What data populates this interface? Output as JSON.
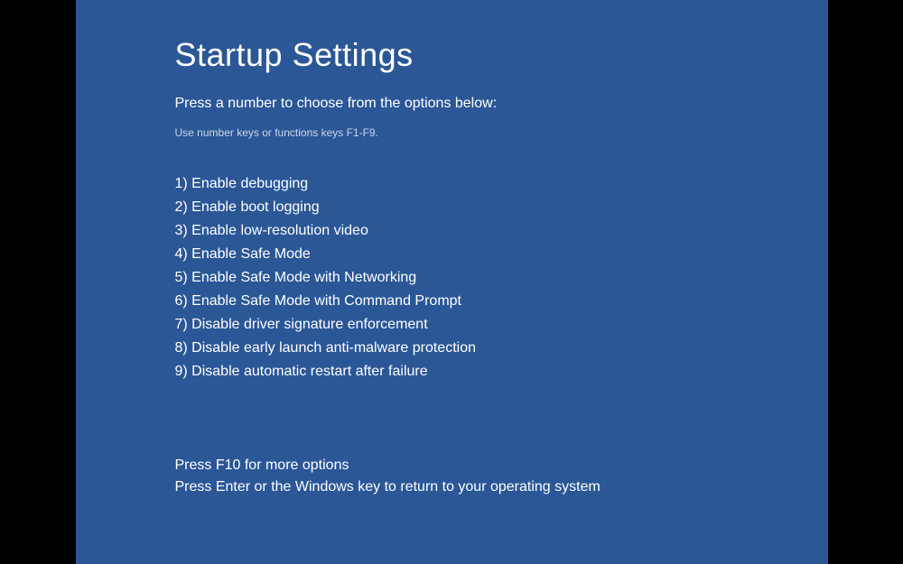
{
  "title": "Startup Settings",
  "subtitle": "Press a number to choose from the options below:",
  "hint": "Use number keys or functions keys F1-F9.",
  "options": [
    "1) Enable debugging",
    "2) Enable boot logging",
    "3) Enable low-resolution video",
    "4) Enable Safe Mode",
    "5) Enable Safe Mode with Networking",
    "6) Enable Safe Mode with Command Prompt",
    "7) Disable driver signature enforcement",
    "8) Disable early launch anti-malware protection",
    "9) Disable automatic restart after failure"
  ],
  "footer": {
    "more_options": "Press F10 for more options",
    "return_hint": "Press Enter or the Windows key to return to your operating system"
  }
}
